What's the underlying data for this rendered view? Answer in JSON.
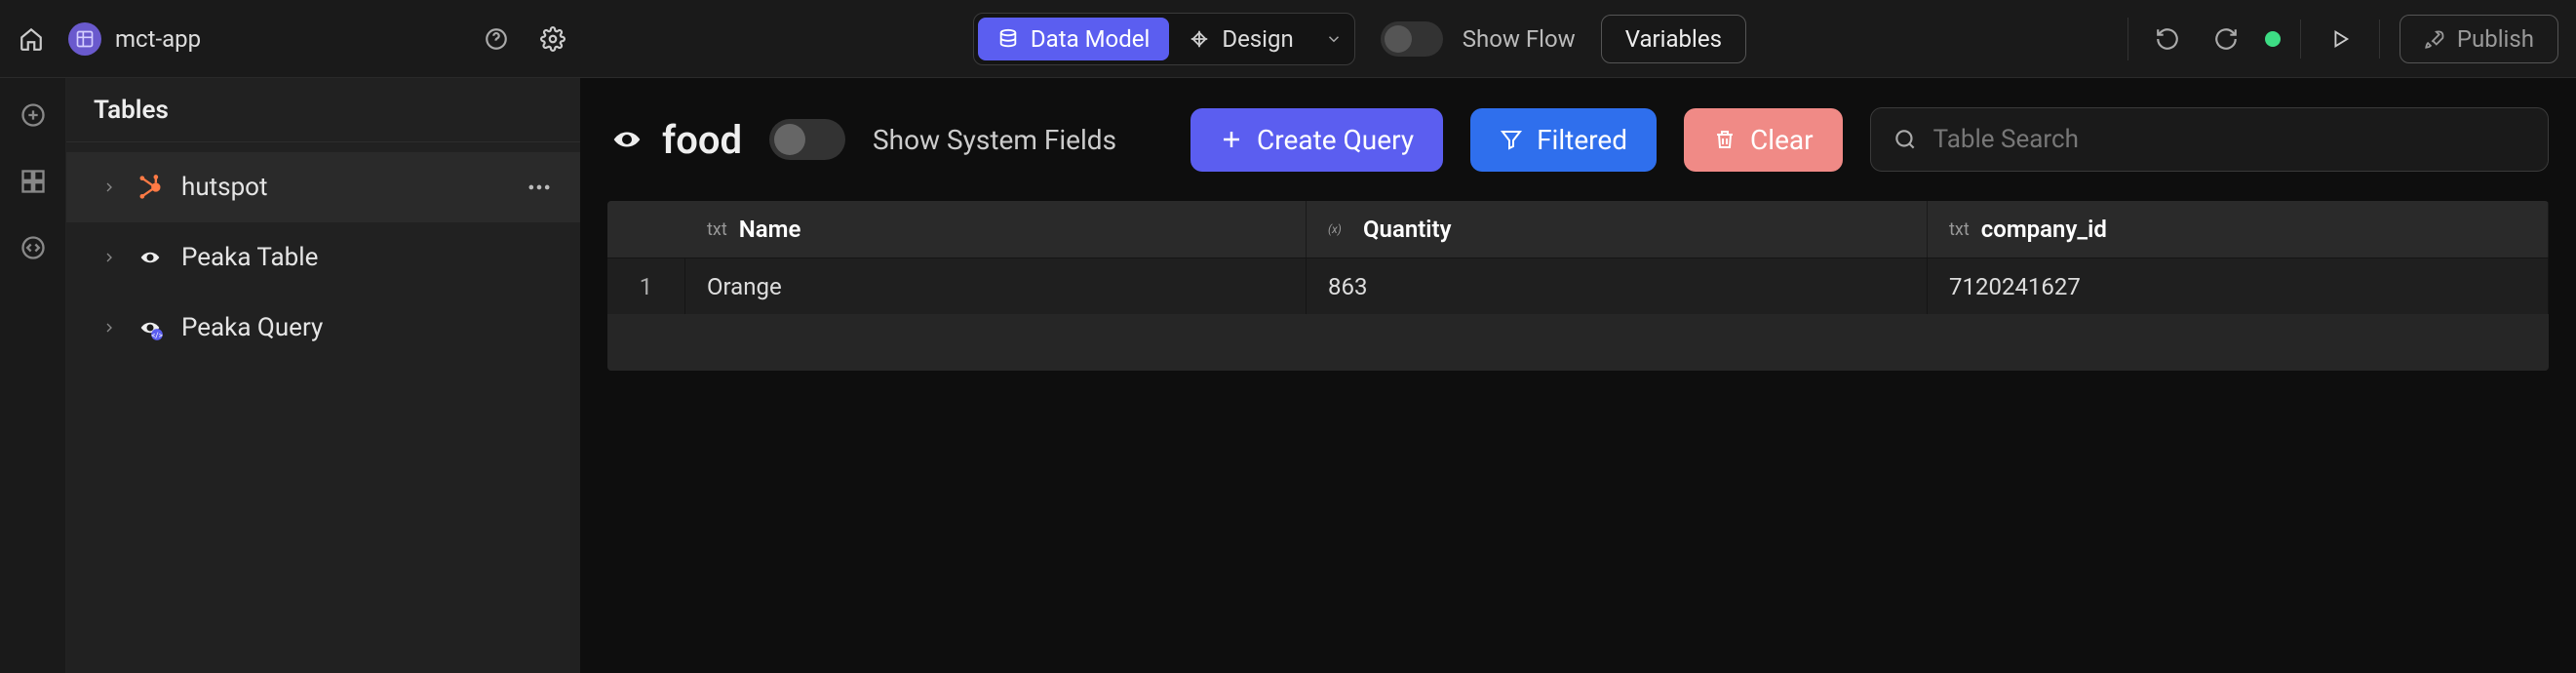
{
  "topbar": {
    "app_name": "mct-app",
    "mode": {
      "data_model": "Data Model",
      "design": "Design"
    },
    "show_flow_label": "Show Flow",
    "variables_label": "Variables",
    "publish_label": "Publish"
  },
  "sidebar": {
    "header": "Tables",
    "items": [
      {
        "label": "hutspot"
      },
      {
        "label": "Peaka Table"
      },
      {
        "label": "Peaka Query"
      }
    ]
  },
  "main": {
    "table_title": "food",
    "show_system_fields_label": "Show System Fields",
    "create_query_label": "Create Query",
    "filtered_label": "Filtered",
    "clear_label": "Clear",
    "search_placeholder": "Table Search",
    "columns": [
      {
        "type": "txt",
        "name": "Name"
      },
      {
        "type": "expr",
        "name": "Quantity"
      },
      {
        "type": "txt",
        "name": "company_id"
      }
    ],
    "rows": [
      {
        "idx": "1",
        "cells": [
          "Orange",
          "863",
          "7120241627"
        ]
      }
    ]
  },
  "icons": {
    "home": "home-icon",
    "help": "help-icon",
    "settings": "gear-icon",
    "database": "database-icon",
    "design": "design-icon",
    "chevdown": "chevron-down-icon",
    "undo": "undo-icon",
    "redo": "redo-icon",
    "play": "play-icon",
    "rocket": "rocket-icon",
    "plus": "plus-icon",
    "grid": "grid-icon",
    "code": "code-icon",
    "chevr": "chevron-right-icon",
    "more": "more-icon",
    "add": "plus-icon",
    "funnel": "funnel-icon",
    "trash": "trash-icon",
    "search": "search-icon"
  }
}
